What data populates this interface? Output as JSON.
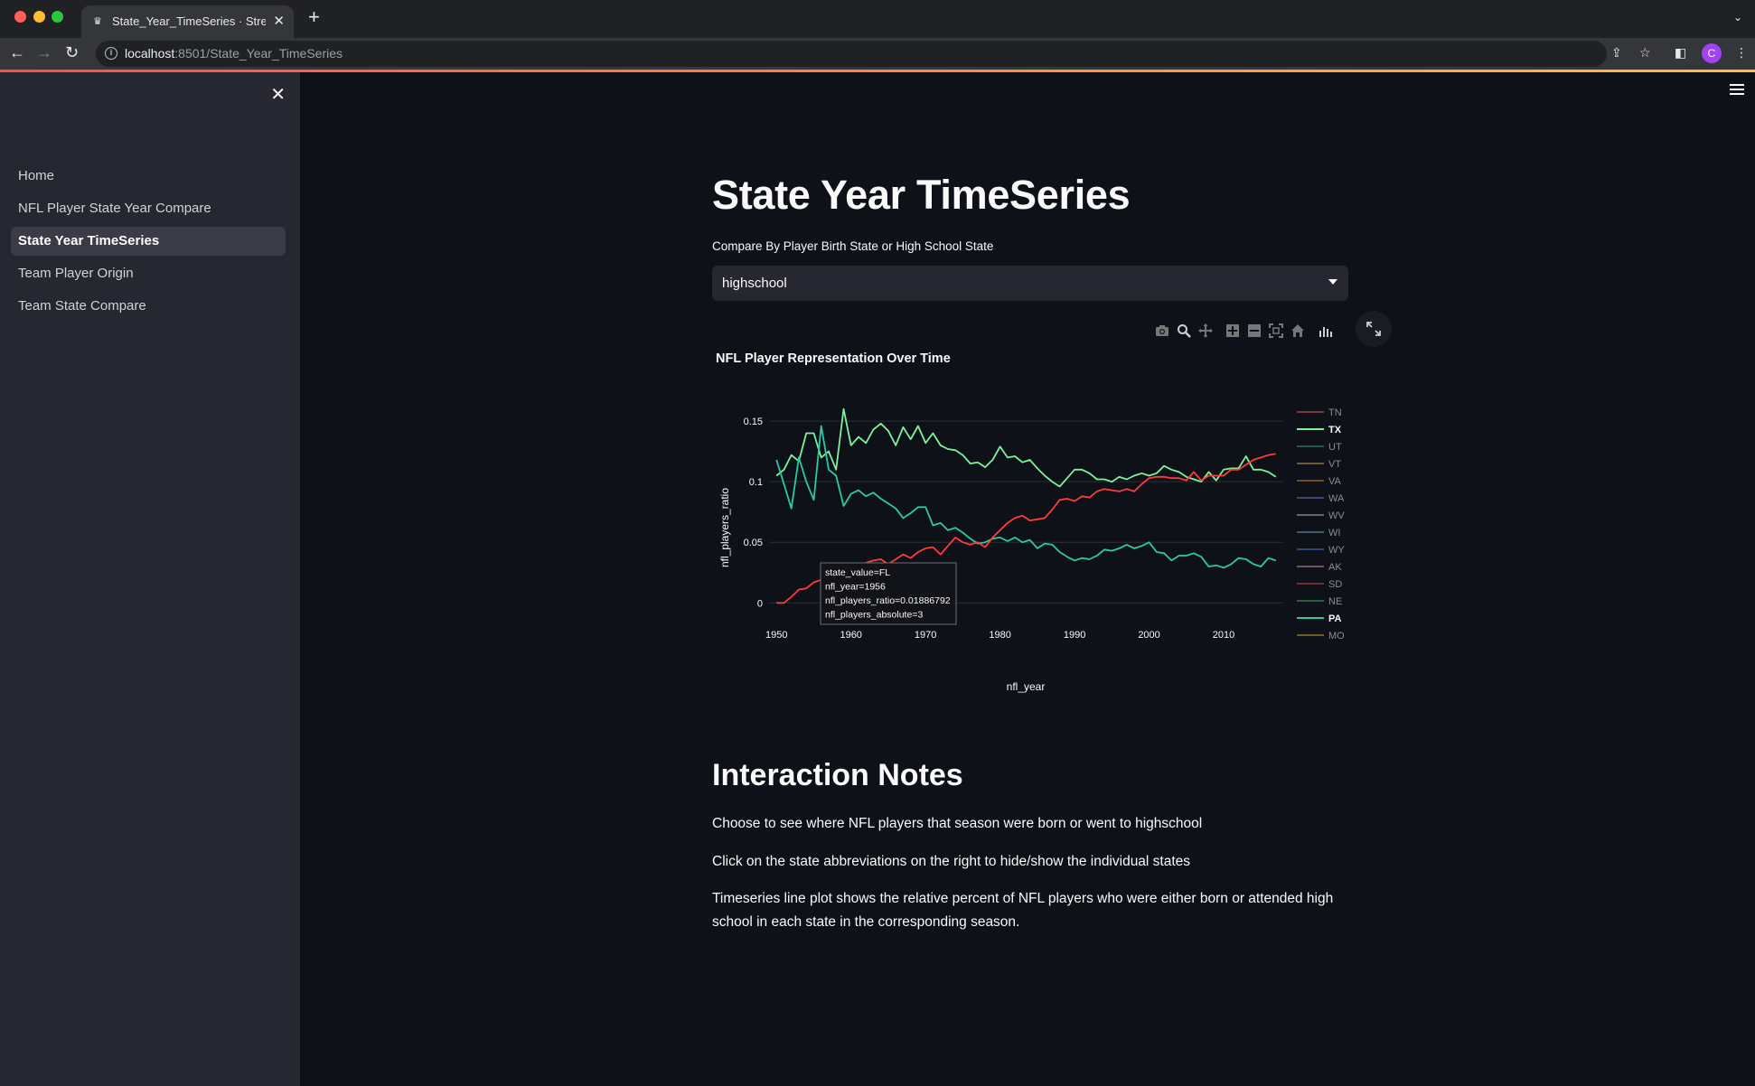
{
  "browser": {
    "tab_title": "State_Year_TimeSeries · Streamlit",
    "url_host": "localhost",
    "url_path": ":8501/State_Year_TimeSeries",
    "avatar_letter": "C"
  },
  "sidebar": {
    "items": [
      {
        "label": "Home",
        "active": false
      },
      {
        "label": "NFL Player State Year Compare",
        "active": false
      },
      {
        "label": "State Year TimeSeries",
        "active": true
      },
      {
        "label": "Team Player Origin",
        "active": false
      },
      {
        "label": "Team State Compare",
        "active": false
      }
    ]
  },
  "main": {
    "title": "State Year TimeSeries",
    "select_label": "Compare By Player Birth State or High School State",
    "select_value": "highschool",
    "notes_title": "Interaction Notes",
    "notes": [
      "Choose to see where NFL players that season were born or went to highschool",
      "Click on the state abbreviations on the right to hide/show the individual states",
      "Timeseries line plot shows the relative percent of NFL players who were either born or attended high school in each state in the corresponding season."
    ]
  },
  "chart_data": {
    "type": "line",
    "title": "NFL Player Representation Over Time",
    "xlabel": "nfl_year",
    "ylabel": "nfl_players_ratio",
    "xlim": [
      1949,
      2018
    ],
    "ylim": [
      -0.005,
      0.165
    ],
    "x_ticks": [
      1950,
      1960,
      1970,
      1980,
      1990,
      2000,
      2010
    ],
    "y_ticks": [
      0,
      0.05,
      0.1,
      0.15
    ],
    "y_tick_labels": [
      "0",
      "0.05",
      "0.1",
      "0.15"
    ],
    "grid": true,
    "legend": [
      {
        "name": "TN",
        "color": "#e85a5a",
        "visible": false
      },
      {
        "name": "TX",
        "color": "#7ef29d",
        "visible": true
      },
      {
        "name": "UT",
        "color": "#3f9e90",
        "visible": false
      },
      {
        "name": "VT",
        "color": "#c9a25a",
        "visible": false
      },
      {
        "name": "VA",
        "color": "#d08a3a",
        "visible": false
      },
      {
        "name": "WA",
        "color": "#8e6ad8",
        "visible": false
      },
      {
        "name": "WV",
        "color": "#b9b9c9",
        "visible": false
      },
      {
        "name": "WI",
        "color": "#6aa7c9",
        "visible": false
      },
      {
        "name": "WY",
        "color": "#5b7fd8",
        "visible": false
      },
      {
        "name": "AK",
        "color": "#d89a9a",
        "visible": false
      },
      {
        "name": "SD",
        "color": "#d84a4a",
        "visible": false
      },
      {
        "name": "NE",
        "color": "#3fae6a",
        "visible": false
      },
      {
        "name": "PA",
        "color": "#2cc9a5",
        "visible": true
      },
      {
        "name": "MO",
        "color": "#c9a23a",
        "visible": false
      }
    ],
    "series": [
      {
        "name": "TX",
        "color": "#7ef29d",
        "x": [
          1950,
          1951,
          1952,
          1953,
          1954,
          1955,
          1956,
          1957,
          1958,
          1959,
          1960,
          1961,
          1962,
          1963,
          1964,
          1965,
          1966,
          1967,
          1968,
          1969,
          1970,
          1971,
          1972,
          1973,
          1974,
          1975,
          1976,
          1977,
          1978,
          1979,
          1980,
          1981,
          1982,
          1983,
          1984,
          1985,
          1986,
          1987,
          1988,
          1989,
          1990,
          1991,
          1992,
          1993,
          1994,
          1995,
          1996,
          1997,
          1998,
          1999,
          2000,
          2001,
          2002,
          2003,
          2004,
          2005,
          2006,
          2007,
          2008,
          2009,
          2010,
          2011,
          2012,
          2013,
          2014,
          2015,
          2016,
          2017
        ],
        "y": [
          0.105,
          0.11,
          0.122,
          0.117,
          0.14,
          0.14,
          0.12,
          0.125,
          0.11,
          0.16,
          0.13,
          0.137,
          0.132,
          0.143,
          0.148,
          0.142,
          0.13,
          0.145,
          0.135,
          0.146,
          0.132,
          0.14,
          0.13,
          0.127,
          0.126,
          0.122,
          0.115,
          0.116,
          0.112,
          0.118,
          0.129,
          0.12,
          0.121,
          0.116,
          0.118,
          0.111,
          0.105,
          0.1,
          0.096,
          0.103,
          0.11,
          0.11,
          0.107,
          0.102,
          0.102,
          0.1,
          0.104,
          0.102,
          0.105,
          0.107,
          0.105,
          0.107,
          0.113,
          0.11,
          0.108,
          0.104,
          0.102,
          0.1,
          0.108,
          0.101,
          0.11,
          0.111,
          0.111,
          0.121,
          0.11,
          0.11,
          0.108,
          0.104
        ]
      },
      {
        "name": "PA",
        "color": "#2cc9a5",
        "x": [
          1950,
          1951,
          1952,
          1953,
          1954,
          1955,
          1956,
          1957,
          1958,
          1959,
          1960,
          1961,
          1962,
          1963,
          1964,
          1965,
          1966,
          1967,
          1968,
          1969,
          1970,
          1971,
          1972,
          1973,
          1974,
          1975,
          1976,
          1977,
          1978,
          1979,
          1980,
          1981,
          1982,
          1983,
          1984,
          1985,
          1986,
          1987,
          1988,
          1989,
          1990,
          1991,
          1992,
          1993,
          1994,
          1995,
          1996,
          1997,
          1998,
          1999,
          2000,
          2001,
          2002,
          2003,
          2004,
          2005,
          2006,
          2007,
          2008,
          2009,
          2010,
          2011,
          2012,
          2013,
          2014,
          2015,
          2016,
          2017
        ],
        "y": [
          0.118,
          0.098,
          0.078,
          0.12,
          0.1,
          0.085,
          0.146,
          0.11,
          0.105,
          0.08,
          0.09,
          0.093,
          0.088,
          0.091,
          0.086,
          0.082,
          0.078,
          0.07,
          0.074,
          0.079,
          0.079,
          0.064,
          0.066,
          0.06,
          0.062,
          0.058,
          0.053,
          0.049,
          0.05,
          0.053,
          0.054,
          0.051,
          0.054,
          0.05,
          0.052,
          0.045,
          0.049,
          0.048,
          0.042,
          0.038,
          0.035,
          0.037,
          0.036,
          0.039,
          0.044,
          0.043,
          0.045,
          0.048,
          0.045,
          0.047,
          0.05,
          0.042,
          0.041,
          0.035,
          0.039,
          0.039,
          0.041,
          0.038,
          0.03,
          0.031,
          0.029,
          0.032,
          0.037,
          0.036,
          0.032,
          0.03,
          0.037,
          0.035
        ]
      },
      {
        "name": "FL",
        "color": "#ff3b3b",
        "x": [
          1950,
          1951,
          1952,
          1953,
          1954,
          1955,
          1956,
          1957,
          1958,
          1959,
          1960,
          1961,
          1962,
          1963,
          1964,
          1965,
          1966,
          1967,
          1968,
          1969,
          1970,
          1971,
          1972,
          1973,
          1974,
          1975,
          1976,
          1977,
          1978,
          1979,
          1980,
          1981,
          1982,
          1983,
          1984,
          1985,
          1986,
          1987,
          1988,
          1989,
          1990,
          1991,
          1992,
          1993,
          1994,
          1995,
          1996,
          1997,
          1998,
          1999,
          2000,
          2001,
          2002,
          2003,
          2004,
          2005,
          2006,
          2007,
          2008,
          2009,
          2010,
          2011,
          2012,
          2013,
          2014,
          2015,
          2016,
          2017
        ],
        "y": [
          0,
          0,
          0.005,
          0.011,
          0.012,
          0.017,
          0.019,
          0.024,
          0.026,
          0.024,
          0.03,
          0.028,
          0.033,
          0.035,
          0.036,
          0.032,
          0.036,
          0.04,
          0.037,
          0.042,
          0.045,
          0.046,
          0.04,
          0.047,
          0.054,
          0.05,
          0.048,
          0.05,
          0.046,
          0.054,
          0.06,
          0.066,
          0.07,
          0.072,
          0.068,
          0.069,
          0.07,
          0.077,
          0.085,
          0.086,
          0.084,
          0.088,
          0.087,
          0.092,
          0.094,
          0.093,
          0.092,
          0.094,
          0.092,
          0.098,
          0.103,
          0.104,
          0.104,
          0.103,
          0.103,
          0.101,
          0.108,
          0.101,
          0.105,
          0.105,
          0.105,
          0.11,
          0.11,
          0.114,
          0.118,
          0.12,
          0.122,
          0.123
        ]
      }
    ],
    "tooltip": {
      "lines": [
        "state_value=FL",
        "nfl_year=1956",
        "nfl_players_ratio=0.01886792",
        "nfl_players_absolute=3"
      ],
      "x": 1956,
      "y": 0.01886792
    }
  }
}
